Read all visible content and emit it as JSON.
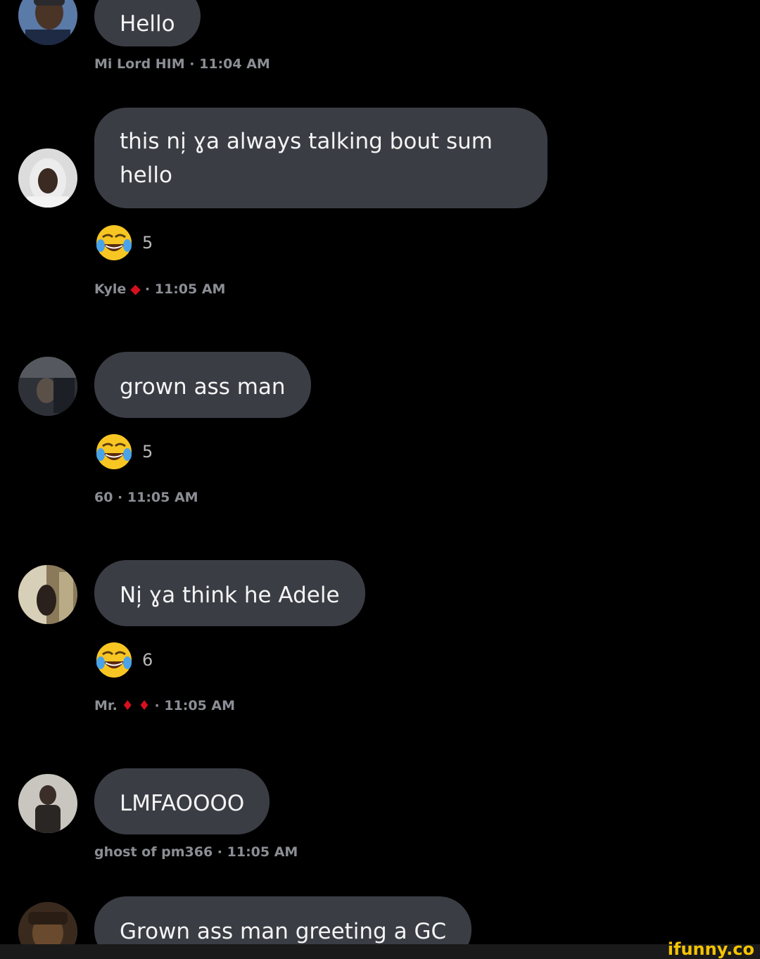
{
  "messages": [
    {
      "text": "Hello"
    },
    {
      "text": "this ni̦ ɣa always talking bout sum hello",
      "reaction_count": "5",
      "meta": {
        "name": "Kyle",
        "glyph": "◆",
        "time": "· 11:05 AM"
      }
    },
    {
      "text": "grown ass man",
      "reaction_count": "5",
      "meta": {
        "name": "",
        "time": "60 · 11:05 AM"
      }
    },
    {
      "text": "Ni̦ ɣa think he Adele",
      "reaction_count": "6",
      "meta": {
        "name": "Mr.",
        "glyph": "♦ ♦",
        "time": "· 11:05 AM"
      }
    },
    {
      "text": "LMFAOOOO",
      "meta": {
        "name": "",
        "time": "ghost of pm366 · 11:05 AM"
      }
    },
    {
      "text": "Grown ass man greeting a GC"
    }
  ],
  "first_meta": "Mi Lord HIM · 11:04 AM",
  "watermark": "ifunny.co",
  "colors": {
    "background": "#000000",
    "bubble": "#3b3d45",
    "meta_text": "#8b8e94",
    "watermark": "#f5c400",
    "drop_red": "#d6101e"
  },
  "icons": {
    "reaction": "face-with-tears-of-joy-icon"
  }
}
